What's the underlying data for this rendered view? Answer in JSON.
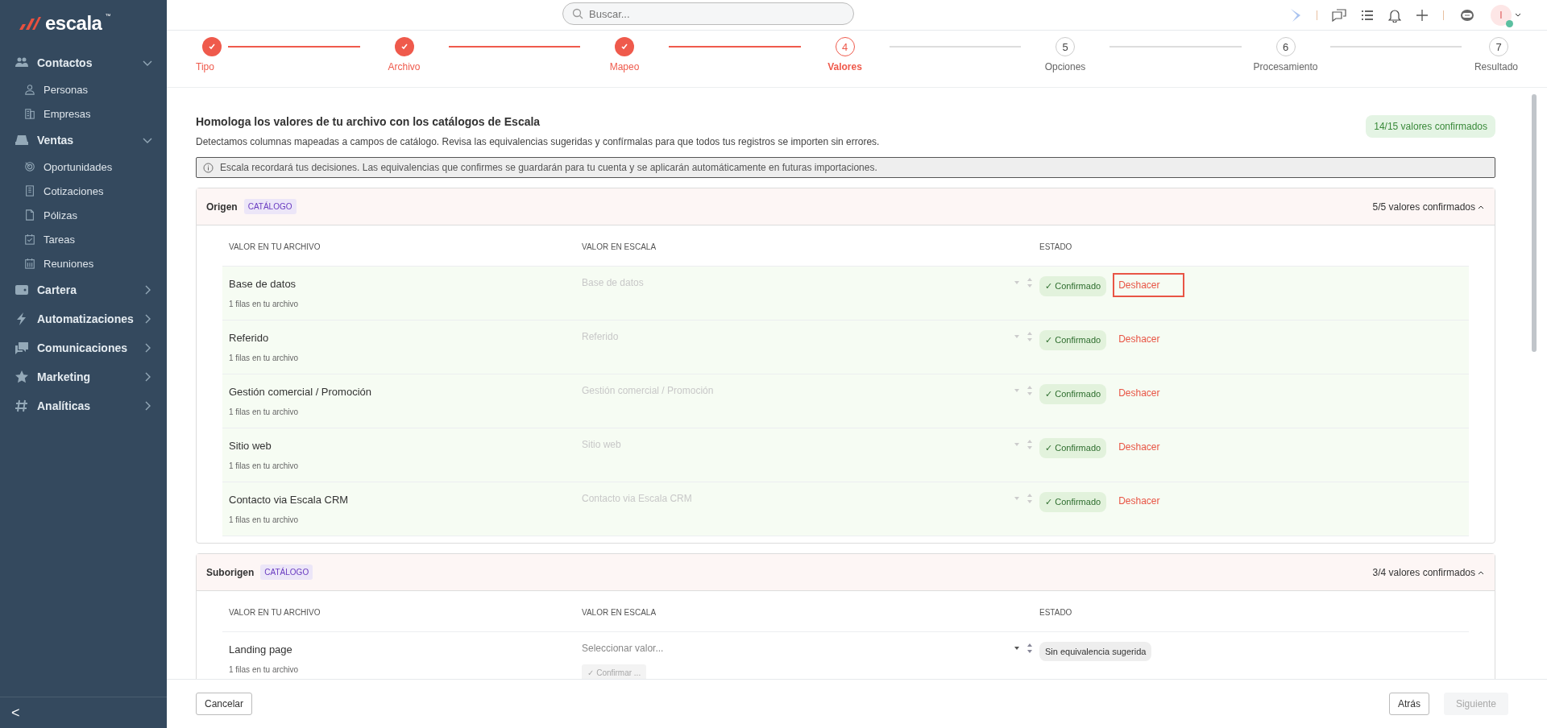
{
  "sidebar": {
    "logo": "escala",
    "logo_mark": "™",
    "groups": [
      {
        "label": "Contactos",
        "expanded": true,
        "children": [
          {
            "label": "Personas"
          },
          {
            "label": "Empresas"
          }
        ]
      },
      {
        "label": "Ventas",
        "expanded": true,
        "children": [
          {
            "label": "Oportunidades"
          },
          {
            "label": "Cotizaciones"
          },
          {
            "label": "Pólizas"
          },
          {
            "label": "Tareas"
          },
          {
            "label": "Reuniones"
          }
        ]
      },
      {
        "label": "Cartera",
        "expanded": false
      },
      {
        "label": "Automatizaciones",
        "expanded": false
      },
      {
        "label": "Comunicaciones",
        "expanded": false
      },
      {
        "label": "Marketing",
        "expanded": false
      },
      {
        "label": "Analíticas",
        "expanded": false
      }
    ],
    "collapse": "<"
  },
  "topbar": {
    "search": {
      "placeholder": "Buscar..."
    },
    "avatar": {
      "initial": "I",
      "online": true
    }
  },
  "steps": [
    {
      "label": "Tipo",
      "done": true,
      "current": false
    },
    {
      "label": "Archivo",
      "done": true,
      "current": false
    },
    {
      "label": "Mapeo",
      "done": true,
      "current": false
    },
    {
      "label": "Valores",
      "number": "4",
      "done": false,
      "current": true
    },
    {
      "label": "Opciones",
      "number": "5",
      "done": false,
      "current": false
    },
    {
      "label": "Procesamiento",
      "number": "6",
      "done": false,
      "current": false
    },
    {
      "label": "Resultado",
      "number": "7",
      "done": false,
      "current": false
    }
  ],
  "header": {
    "title": "Homologa los valores de tu archivo con los catálogos de Escala",
    "description": "Detectamos columnas mapeadas a campos de catálogo. Revisa las equivalencias sugeridas y confírmalas para que todos tus registros se importen sin errores.",
    "summary": "14/15 valores confirmados",
    "notice": "Escala recordará tus decisiones. Las equivalencias que confirmes se guardarán para tu cuenta y se aplicarán automáticamente en futuras importaciones."
  },
  "sections": [
    {
      "name": "Origen",
      "tag": "CATÁLOGO",
      "summary": "5/5 valores confirmados",
      "expanded": true,
      "columns": [
        "VALOR EN TU ARCHIVO",
        "VALOR EN ESCALA",
        "ESTADO"
      ],
      "rows": [
        {
          "value": "Base de datos",
          "count": "1 filas en tu archivo",
          "mapped": "Base de datos",
          "confirmed": true,
          "status_label": "✓ Confirmado",
          "action": "Deshacer",
          "focused": true
        },
        {
          "value": "Referido",
          "count": "1 filas en tu archivo",
          "mapped": "Referido",
          "confirmed": true,
          "status_label": "✓ Confirmado",
          "action": "Deshacer",
          "focused": false
        },
        {
          "value": "Gestión comercial / Promoción",
          "count": "1 filas en tu archivo",
          "mapped": "Gestión comercial / Promoción",
          "confirmed": true,
          "status_label": "✓ Confirmado",
          "action": "Deshacer",
          "focused": false
        },
        {
          "value": "Sitio web",
          "count": "1 filas en tu archivo",
          "mapped": "Sitio web",
          "confirmed": true,
          "status_label": "✓ Confirmado",
          "action": "Deshacer",
          "focused": false
        },
        {
          "value": "Contacto via Escala CRM",
          "count": "1 filas en tu archivo",
          "mapped": "Contacto via Escala CRM",
          "confirmed": true,
          "status_label": "✓ Confirmado",
          "action": "Deshacer",
          "focused": false
        }
      ]
    },
    {
      "name": "Suborigen",
      "tag": "CATÁLOGO",
      "summary": "3/4 valores confirmados",
      "expanded": true,
      "columns": [
        "VALOR EN TU ARCHIVO",
        "VALOR EN ESCALA",
        "ESTADO"
      ],
      "rows": [
        {
          "value": "Landing page",
          "count": "1 filas en tu archivo",
          "placeholder": "Seleccionar valor...",
          "confirmed": false,
          "status_label": "Sin equivalencia sugerida",
          "confirm": "✓ Confirmar ...",
          "confirm_disabled": true
        }
      ]
    }
  ],
  "footer": {
    "cancel": "Cancelar",
    "back": "Atrás",
    "next": "Siguiente",
    "next_disabled": true
  }
}
